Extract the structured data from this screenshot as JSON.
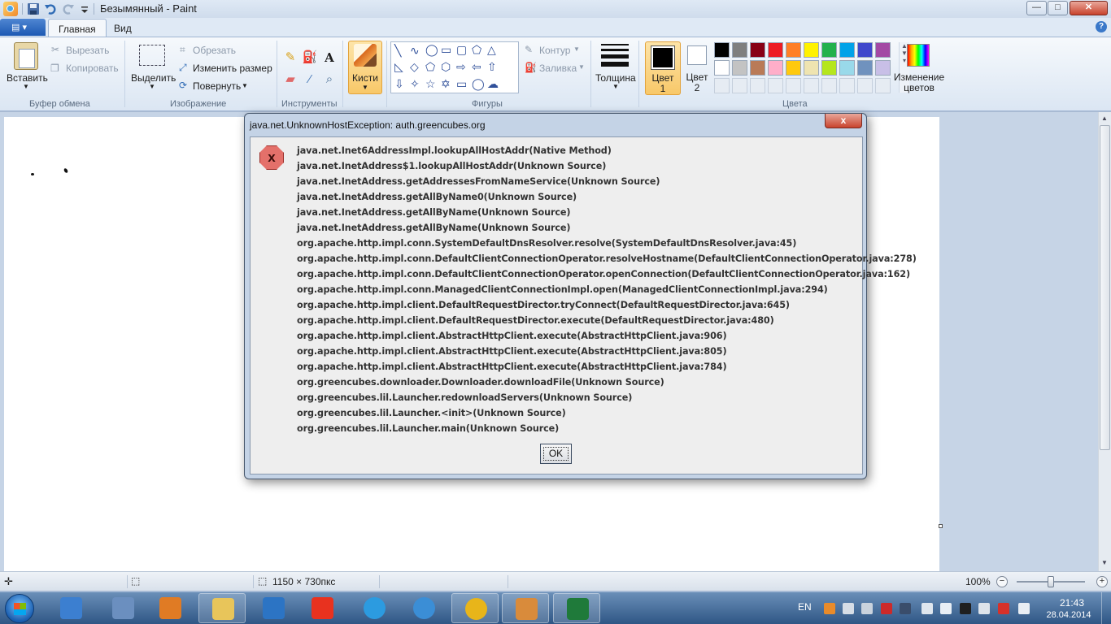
{
  "window": {
    "title": "Безымянный - Paint",
    "buttons": {
      "minimize": "—",
      "maximize": "□",
      "close": "✕"
    }
  },
  "tabs": {
    "home": "Главная",
    "view": "Вид"
  },
  "ribbon": {
    "clipboard": {
      "paste": "Вставить",
      "cut": "Вырезать",
      "copy": "Копировать",
      "label": "Буфер обмена"
    },
    "image": {
      "select": "Выделить",
      "crop": "Обрезать",
      "resize": "Изменить размер",
      "rotate": "Повернуть",
      "label": "Изображение"
    },
    "tools": {
      "label": "Инструменты"
    },
    "brushes": {
      "label": "Кисти"
    },
    "shapes": {
      "outline": "Контур",
      "fill": "Заливка",
      "label": "Фигуры"
    },
    "thickness": {
      "label": "Толщина"
    },
    "colors": {
      "color1": "Цвет 1",
      "color2": "Цвет 2",
      "edit_colors": "Изменение цветов",
      "label": "Цвета",
      "palette_row1": [
        "#000000",
        "#7f7f7f",
        "#880015",
        "#ed1c24",
        "#ff7f27",
        "#fff200",
        "#22b14c",
        "#00a2e8",
        "#3f48cc",
        "#a349a4"
      ],
      "palette_row2": [
        "#ffffff",
        "#c3c3c3",
        "#b97a57",
        "#ffaec9",
        "#ffc90e",
        "#efe4b0",
        "#b5e61d",
        "#99d9ea",
        "#7092be",
        "#c8bfe7"
      ]
    }
  },
  "dialog": {
    "title": "java.net.UnknownHostException: auth.greencubes.org",
    "close": "x",
    "error_icon": "x",
    "trace": [
      "java.net.Inet6AddressImpl.lookupAllHostAddr(Native Method)",
      "java.net.InetAddress$1.lookupAllHostAddr(Unknown Source)",
      "java.net.InetAddress.getAddressesFromNameService(Unknown Source)",
      "java.net.InetAddress.getAllByName0(Unknown Source)",
      "java.net.InetAddress.getAllByName(Unknown Source)",
      "java.net.InetAddress.getAllByName(Unknown Source)",
      "org.apache.http.impl.conn.SystemDefaultDnsResolver.resolve(SystemDefaultDnsResolver.java:45)",
      "org.apache.http.impl.conn.DefaultClientConnectionOperator.resolveHostname(DefaultClientConnectionOperator.java:278)",
      "org.apache.http.impl.conn.DefaultClientConnectionOperator.openConnection(DefaultClientConnectionOperator.java:162)",
      "org.apache.http.impl.conn.ManagedClientConnectionImpl.open(ManagedClientConnectionImpl.java:294)",
      "org.apache.http.impl.client.DefaultRequestDirector.tryConnect(DefaultRequestDirector.java:645)",
      "org.apache.http.impl.client.DefaultRequestDirector.execute(DefaultRequestDirector.java:480)",
      "org.apache.http.impl.client.AbstractHttpClient.execute(AbstractHttpClient.java:906)",
      "org.apache.http.impl.client.AbstractHttpClient.execute(AbstractHttpClient.java:805)",
      "org.apache.http.impl.client.AbstractHttpClient.execute(AbstractHttpClient.java:784)",
      "org.greencubes.downloader.Downloader.downloadFile(Unknown Source)",
      "org.greencubes.lil.Launcher.redownloadServers(Unknown Source)",
      "org.greencubes.lil.Launcher.<init>(Unknown Source)",
      "org.greencubes.lil.Launcher.main(Unknown Source)"
    ],
    "ok": "OK"
  },
  "statusbar": {
    "canvas_size": "1150 × 730пкс",
    "zoom": "100%"
  },
  "taskbar": {
    "lang": "EN",
    "time": "21:43",
    "date": "28.04.2014",
    "items": [
      {
        "name": "media-player-icon",
        "color": "#3c7fd0"
      },
      {
        "name": "tools-icon",
        "color": "#6b8fbf"
      },
      {
        "name": "video-icon",
        "color": "#e07b24"
      },
      {
        "name": "explorer-icon",
        "color": "#e8c55a"
      },
      {
        "name": "mail-icon",
        "color": "#2c74c4"
      },
      {
        "name": "yandex-icon",
        "color": "#e8321f"
      },
      {
        "name": "ie-icon",
        "color": "#2c9be0"
      },
      {
        "name": "network-icon",
        "color": "#3b8ed6"
      },
      {
        "name": "chrome-icon",
        "color": "#e8b51a"
      },
      {
        "name": "paint-icon",
        "color": "#d98b3b"
      },
      {
        "name": "greencubes-icon",
        "color": "#1f7a3a"
      }
    ]
  }
}
